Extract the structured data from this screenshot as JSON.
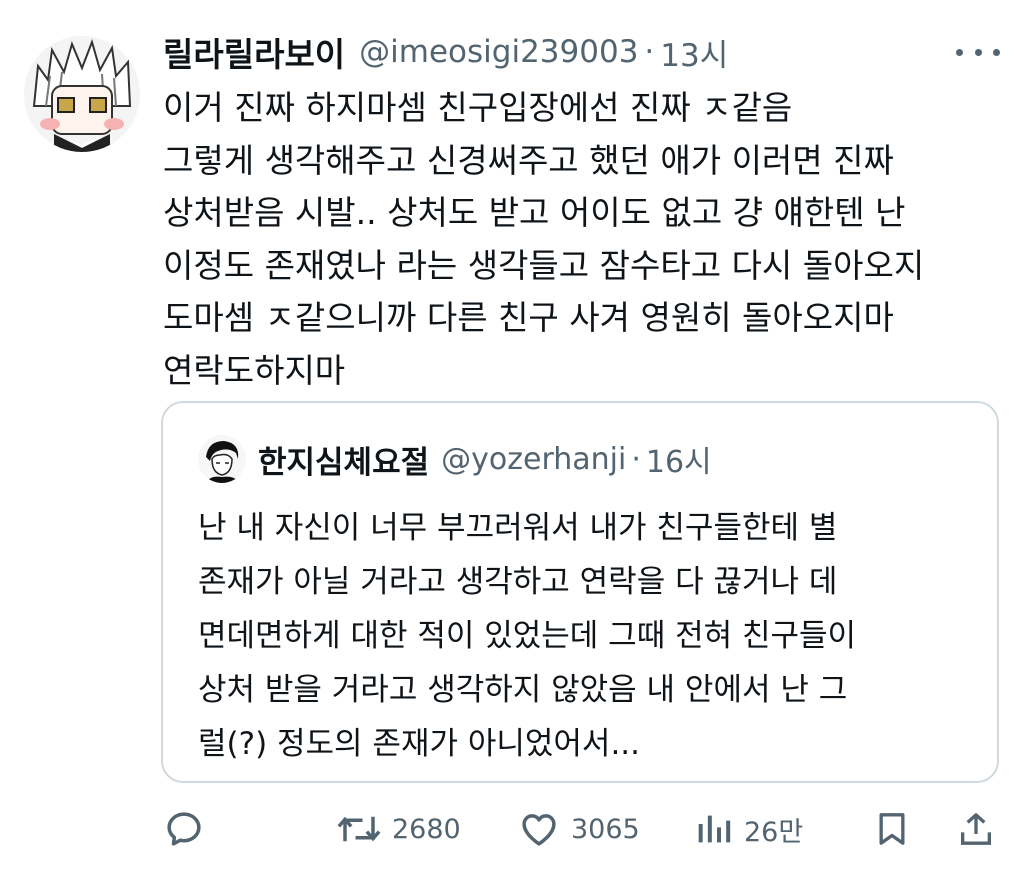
{
  "tweet": {
    "author_name": "릴라릴라보이",
    "handle": "@imeosigi239003",
    "dot": "·",
    "time": "13시",
    "text": "이거 진짜 하지마셈 친구입장에선 진짜 ㅈ같음\n그렇게 생각해주고 신경써주고 했던 애가 이러면 진짜\n상처받음 시발.. 상처도 받고 어이도 없고 걍 얘한텐 난\n이정도 존재였나 라는 생각들고 잠수타고 다시 돌아오지\n도마셈 ㅈ같으니까 다른 친구 사겨 영원히 돌아오지마\n연락도하지마"
  },
  "quote": {
    "author_name": "한지심체요절",
    "handle": "@yozerhanji",
    "dot": "·",
    "time": "16시",
    "text": "난 내 자신이 너무 부끄러워서 내가 친구들한테 별\n존재가 아닐 거라고 생각하고 연락을 다 끊거나 데\n면데면하게 대한 적이 있었는데 그때 전혀 친구들이\n상처 받을 거라고 생각하지 않았음 내 안에서 난 그\n럴(?) 정도의 존재가 아니었어서..."
  },
  "actions": {
    "reply_icon": "reply-icon",
    "retweet_count": "2680",
    "like_count": "3065",
    "views_count": "26만"
  },
  "colors": {
    "text": "#0f1419",
    "secondary": "#536471",
    "border": "#cfd9de"
  }
}
